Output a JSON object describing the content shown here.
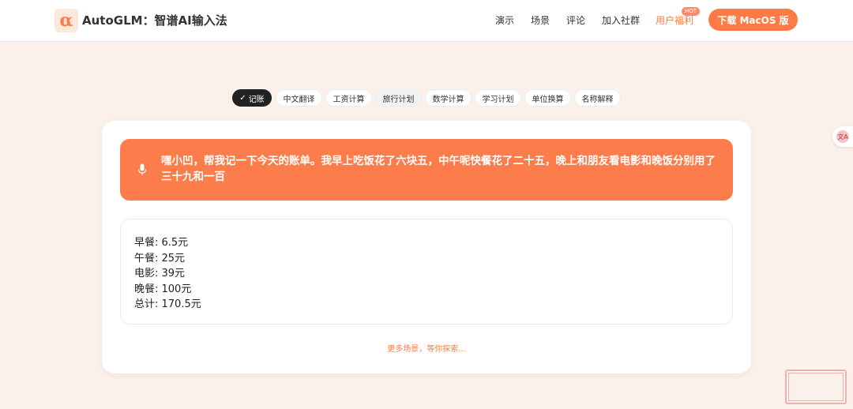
{
  "header": {
    "logo_glyph": "α",
    "brand": "AutoGLM：智谱AI输入法",
    "nav": [
      "演示",
      "场景",
      "评论",
      "加入社群",
      "用户福利"
    ],
    "hot_badge": "HOT",
    "download": "下载 MacOS 版"
  },
  "tabs": {
    "check": "✓",
    "items": [
      "记账",
      "中文翻译",
      "工资计算",
      "旅行计划",
      "数学计算",
      "学习计划",
      "单位换算",
      "名称解释"
    ]
  },
  "demo": {
    "voice_input": "嘿小凹，帮我记一下今天的账单。我早上吃饭花了六块五，中午呢快餐花了二十五，晚上和朋友看电影和晚饭分别用了三十九和一百",
    "result_lines": [
      "早餐: 6.5元",
      "午餐: 25元",
      "电影: 39元",
      "晚餐: 100元",
      "总计: 170.5元"
    ],
    "more": "更多场景，等你探索..."
  },
  "side": {
    "glyph": "文A"
  },
  "colors": {
    "accent": "#ff7a45",
    "voice_bg": "#fd7c4b",
    "page_bg": "#fbf1ea",
    "tab_active": "#222222"
  }
}
